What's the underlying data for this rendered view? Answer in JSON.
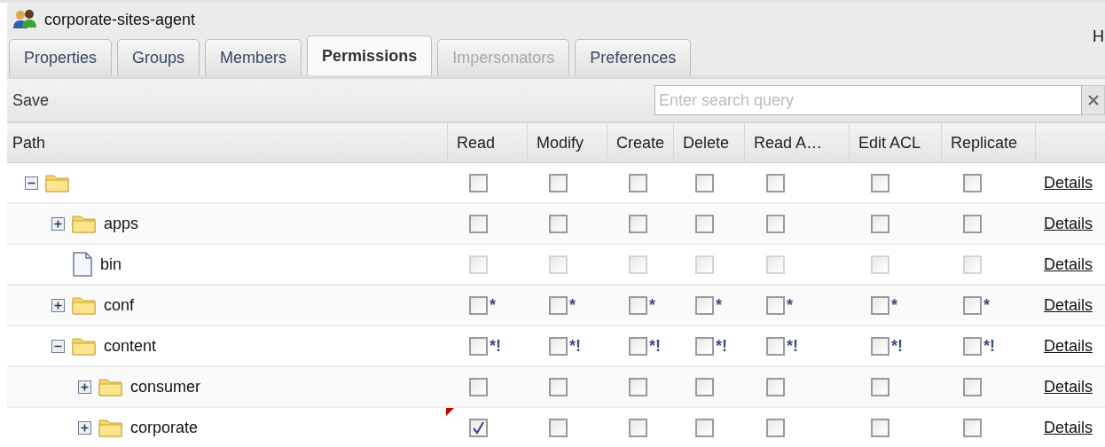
{
  "window": {
    "title": "corporate-sites-agent",
    "edge_text": "H"
  },
  "tabs": [
    {
      "label": "Properties",
      "selected": false,
      "disabled": false
    },
    {
      "label": "Groups",
      "selected": false,
      "disabled": false
    },
    {
      "label": "Members",
      "selected": false,
      "disabled": false
    },
    {
      "label": "Permissions",
      "selected": true,
      "disabled": false
    },
    {
      "label": "Impersonators",
      "selected": false,
      "disabled": true
    },
    {
      "label": "Preferences",
      "selected": false,
      "disabled": false
    }
  ],
  "toolbar": {
    "save": "Save",
    "search": {
      "placeholder": "Enter search query"
    }
  },
  "table": {
    "columns": [
      "Path",
      "Read",
      "Modify",
      "Create",
      "Delete",
      "Read A…",
      "Edit ACL",
      "Replicate"
    ],
    "rows": [
      {
        "name": "",
        "kind": "folder",
        "expanded": true,
        "modified": false,
        "link": "Details",
        "permissions": [
          {
            "checked": false,
            "disabled": false
          },
          {
            "checked": false,
            "disabled": false
          },
          {
            "checked": false,
            "disabled": false
          },
          {
            "checked": false,
            "disabled": false
          },
          {
            "checked": false,
            "disabled": false
          },
          {
            "checked": false,
            "disabled": false
          },
          {
            "checked": false,
            "disabled": false
          }
        ],
        "children": [
          {
            "name": "apps",
            "kind": "folder",
            "expanded": false,
            "modified": false,
            "link": "Details",
            "permissions": [
              {
                "checked": false,
                "disabled": false
              },
              {
                "checked": false,
                "disabled": false
              },
              {
                "checked": false,
                "disabled": false
              },
              {
                "checked": false,
                "disabled": false
              },
              {
                "checked": false,
                "disabled": false
              },
              {
                "checked": false,
                "disabled": false
              },
              {
                "checked": false,
                "disabled": false
              }
            ]
          },
          {
            "name": "bin",
            "kind": "file",
            "modified": false,
            "link": "Details",
            "permissions": [
              {
                "checked": false,
                "disabled": true
              },
              {
                "checked": false,
                "disabled": true
              },
              {
                "checked": false,
                "disabled": true
              },
              {
                "checked": false,
                "disabled": true
              },
              {
                "checked": false,
                "disabled": true
              },
              {
                "checked": false,
                "disabled": true
              },
              {
                "checked": false,
                "disabled": true
              }
            ]
          },
          {
            "name": "conf",
            "kind": "folder",
            "expanded": false,
            "modified": false,
            "link": "Details",
            "permissions": [
              {
                "checked": false,
                "disabled": false,
                "marker": "*"
              },
              {
                "checked": false,
                "disabled": false,
                "marker": "*"
              },
              {
                "checked": false,
                "disabled": false,
                "marker": "*"
              },
              {
                "checked": false,
                "disabled": false,
                "marker": "*"
              },
              {
                "checked": false,
                "disabled": false,
                "marker": "*"
              },
              {
                "checked": false,
                "disabled": false,
                "marker": "*"
              },
              {
                "checked": false,
                "disabled": false,
                "marker": "*"
              }
            ]
          },
          {
            "name": "content",
            "kind": "folder",
            "expanded": true,
            "modified": false,
            "link": "Details",
            "permissions": [
              {
                "checked": false,
                "disabled": false,
                "marker": "*!"
              },
              {
                "checked": false,
                "disabled": false,
                "marker": "*!"
              },
              {
                "checked": false,
                "disabled": false,
                "marker": "*!"
              },
              {
                "checked": false,
                "disabled": false,
                "marker": "*!"
              },
              {
                "checked": false,
                "disabled": false,
                "marker": "*!"
              },
              {
                "checked": false,
                "disabled": false,
                "marker": "*!"
              },
              {
                "checked": false,
                "disabled": false,
                "marker": "*!"
              }
            ],
            "children": [
              {
                "name": "consumer",
                "kind": "folder",
                "expanded": false,
                "modified": false,
                "link": "Details",
                "permissions": [
                  {
                    "checked": false,
                    "disabled": false
                  },
                  {
                    "checked": false,
                    "disabled": false
                  },
                  {
                    "checked": false,
                    "disabled": false
                  },
                  {
                    "checked": false,
                    "disabled": false
                  },
                  {
                    "checked": false,
                    "disabled": false
                  },
                  {
                    "checked": false,
                    "disabled": false
                  },
                  {
                    "checked": false,
                    "disabled": false
                  }
                ]
              },
              {
                "name": "corporate",
                "kind": "folder",
                "expanded": false,
                "modified": true,
                "link": "Details",
                "permissions": [
                  {
                    "checked": true,
                    "disabled": false
                  },
                  {
                    "checked": false,
                    "disabled": false
                  },
                  {
                    "checked": false,
                    "disabled": false
                  },
                  {
                    "checked": false,
                    "disabled": false
                  },
                  {
                    "checked": false,
                    "disabled": false
                  },
                  {
                    "checked": false,
                    "disabled": false
                  },
                  {
                    "checked": false,
                    "disabled": false
                  }
                ]
              }
            ]
          }
        ]
      }
    ]
  }
}
